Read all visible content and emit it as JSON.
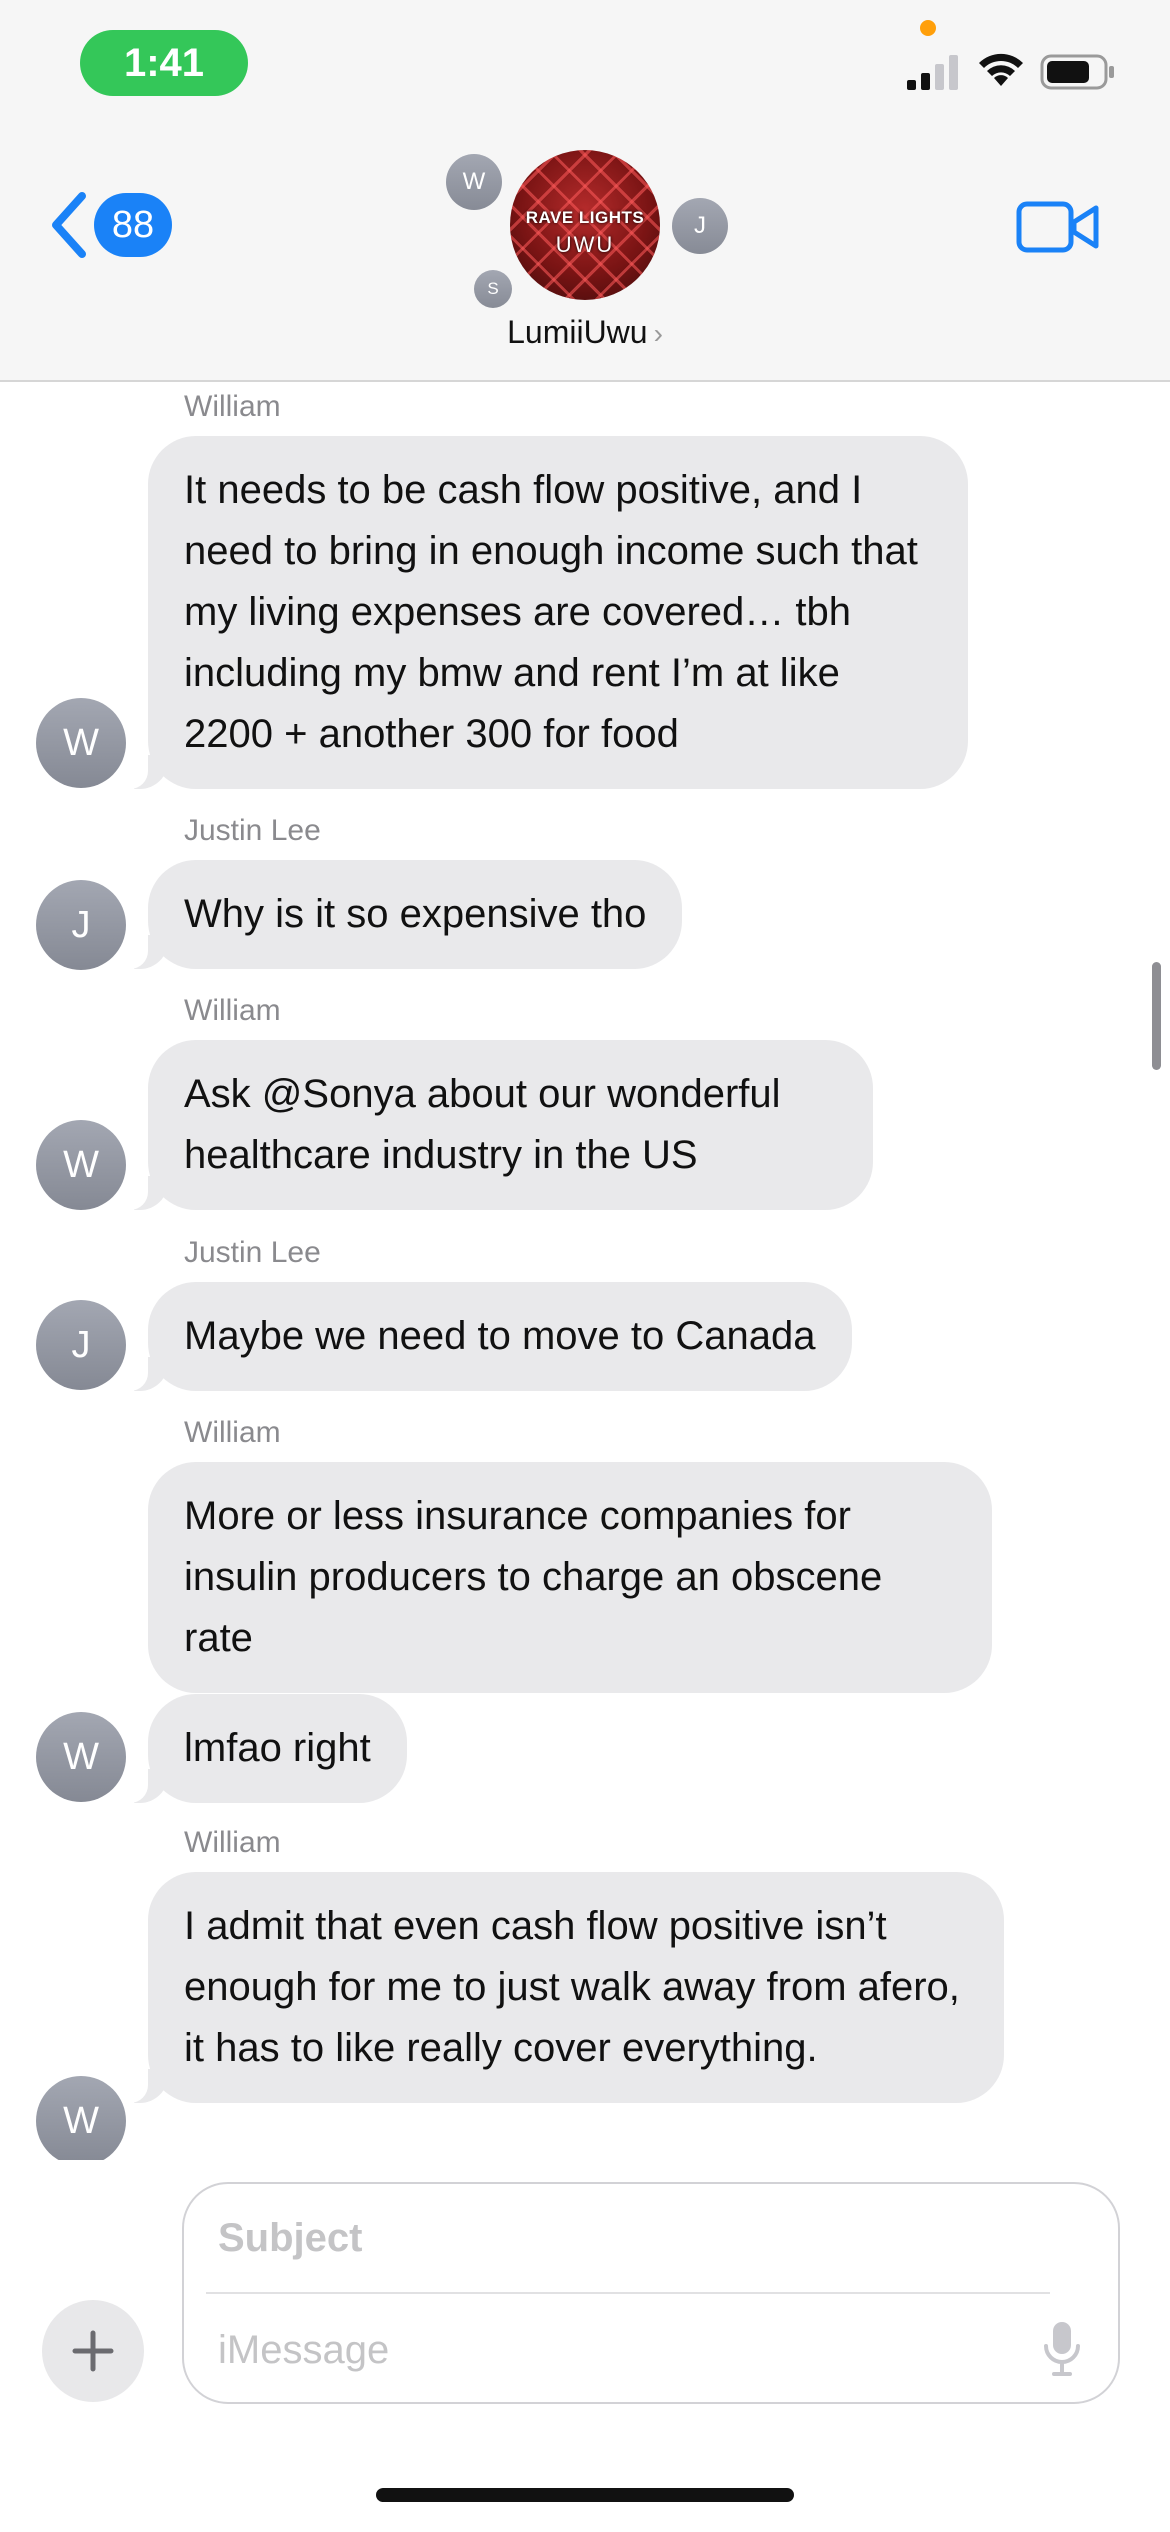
{
  "status_bar": {
    "time": "1:41",
    "icons": [
      "cellular-signal-icon",
      "wifi-icon",
      "battery-icon"
    ],
    "time_pill_color": "#34c759"
  },
  "header": {
    "back_count": "88",
    "group_avatar_line1": "RAVE LIGHTS",
    "group_avatar_line2": "UWU",
    "member_initials": [
      "W",
      "J",
      "S"
    ],
    "group_name": "LumiiUwu",
    "accent_color": "#1a82f7"
  },
  "messages": [
    {
      "sender": "William",
      "text": "It needs to be cash flow positive, and I need to bring in enough income such that my living expenses are covered… tbh including my bmw and rent I’m at like 2200 + another 300 for food",
      "initial": "W"
    },
    {
      "sender": "Justin Lee",
      "text": "Why is it so expensive tho",
      "initial": "J"
    },
    {
      "sender": "William",
      "text": "Ask @Sonya about our wonderful healthcare industry in the US",
      "initial": "W"
    },
    {
      "sender": "Justin Lee",
      "text": "Maybe we need to move to Canada",
      "initial": "J"
    },
    {
      "sender": "William",
      "text": "More or less insurance companies for insulin producers to charge an obscene rate",
      "initial": ""
    },
    {
      "sender": "",
      "text": "lmfao right",
      "initial": "W"
    },
    {
      "sender": "William",
      "text": "I admit that even cash flow positive isn’t enough for me to just walk away from afero, it has to like really cover everything.",
      "initial": "W"
    }
  ],
  "composer": {
    "subject_placeholder": "Subject",
    "message_placeholder": "iMessage"
  }
}
